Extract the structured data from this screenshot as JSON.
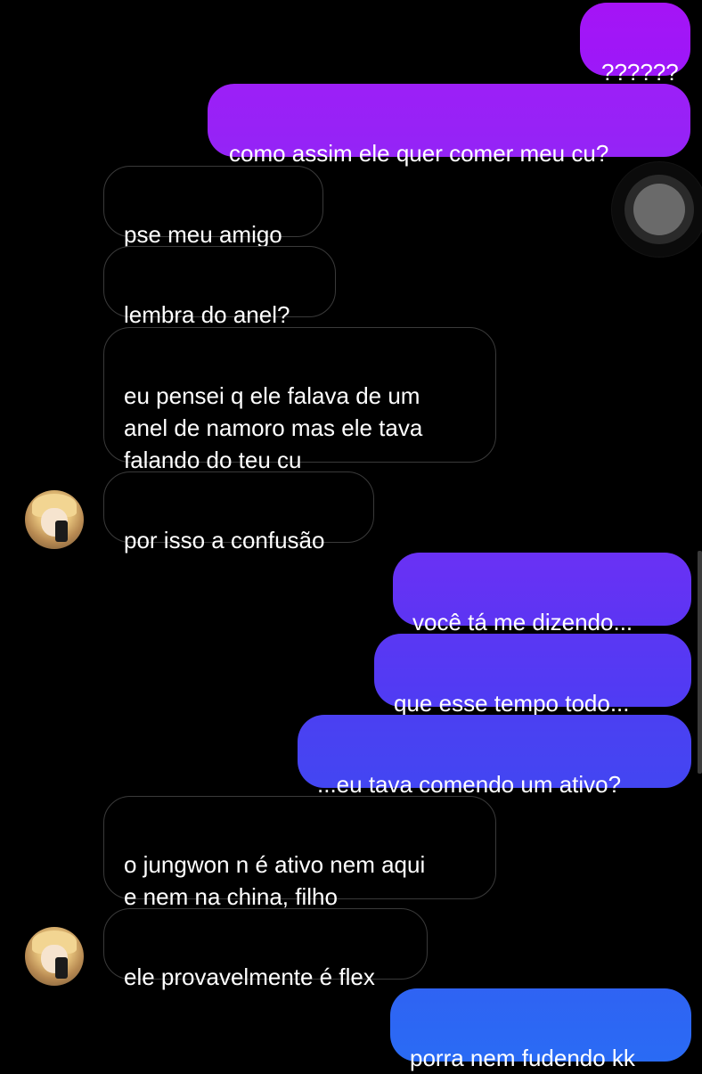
{
  "messages": [
    {
      "id": "m1",
      "direction": "outgoing",
      "text": "??????",
      "color_top": "#a514f6",
      "color_bottom": "#9c18f8"
    },
    {
      "id": "m2",
      "direction": "outgoing",
      "text": "como assim ele quer comer meu cu?",
      "color_top": "#9c1ff7",
      "color_bottom": "#9424f6"
    },
    {
      "id": "m3",
      "direction": "incoming",
      "text": "pse meu amigo"
    },
    {
      "id": "m4",
      "direction": "incoming",
      "text": "lembra do anel?"
    },
    {
      "id": "m5",
      "direction": "incoming",
      "text": "eu pensei q ele falava de um\nanel de namoro mas ele tava\nfalando do teu cu"
    },
    {
      "id": "m6",
      "direction": "incoming",
      "text": "por isso a confusão"
    },
    {
      "id": "m7",
      "direction": "outgoing",
      "text": "você tá me dizendo...",
      "color_top": "#6a31f4",
      "color_bottom": "#5c35f3"
    },
    {
      "id": "m8",
      "direction": "outgoing",
      "text": "que esse tempo todo...",
      "color_top": "#5a37f3",
      "color_bottom": "#4f3cf3"
    },
    {
      "id": "m9",
      "direction": "outgoing",
      "text": "...eu tava comendo um ativo?",
      "color_top": "#4b40f2",
      "color_bottom": "#4346f2"
    },
    {
      "id": "m10",
      "direction": "incoming",
      "text": "o jungwon n é ativo nem aqui\ne nem na china, filho"
    },
    {
      "id": "m11",
      "direction": "incoming",
      "text": "ele provavelmente é flex"
    },
    {
      "id": "m12",
      "direction": "outgoing",
      "text": "porra nem fudendo kk",
      "color_top": "#2f63f3",
      "color_bottom": "#2a6bf4"
    }
  ],
  "avatars": [
    {
      "id": "a1",
      "icon": "profile-avatar"
    },
    {
      "id": "a2",
      "icon": "profile-avatar"
    }
  ],
  "floating_button": {
    "icon": "assistive-touch-icon"
  }
}
